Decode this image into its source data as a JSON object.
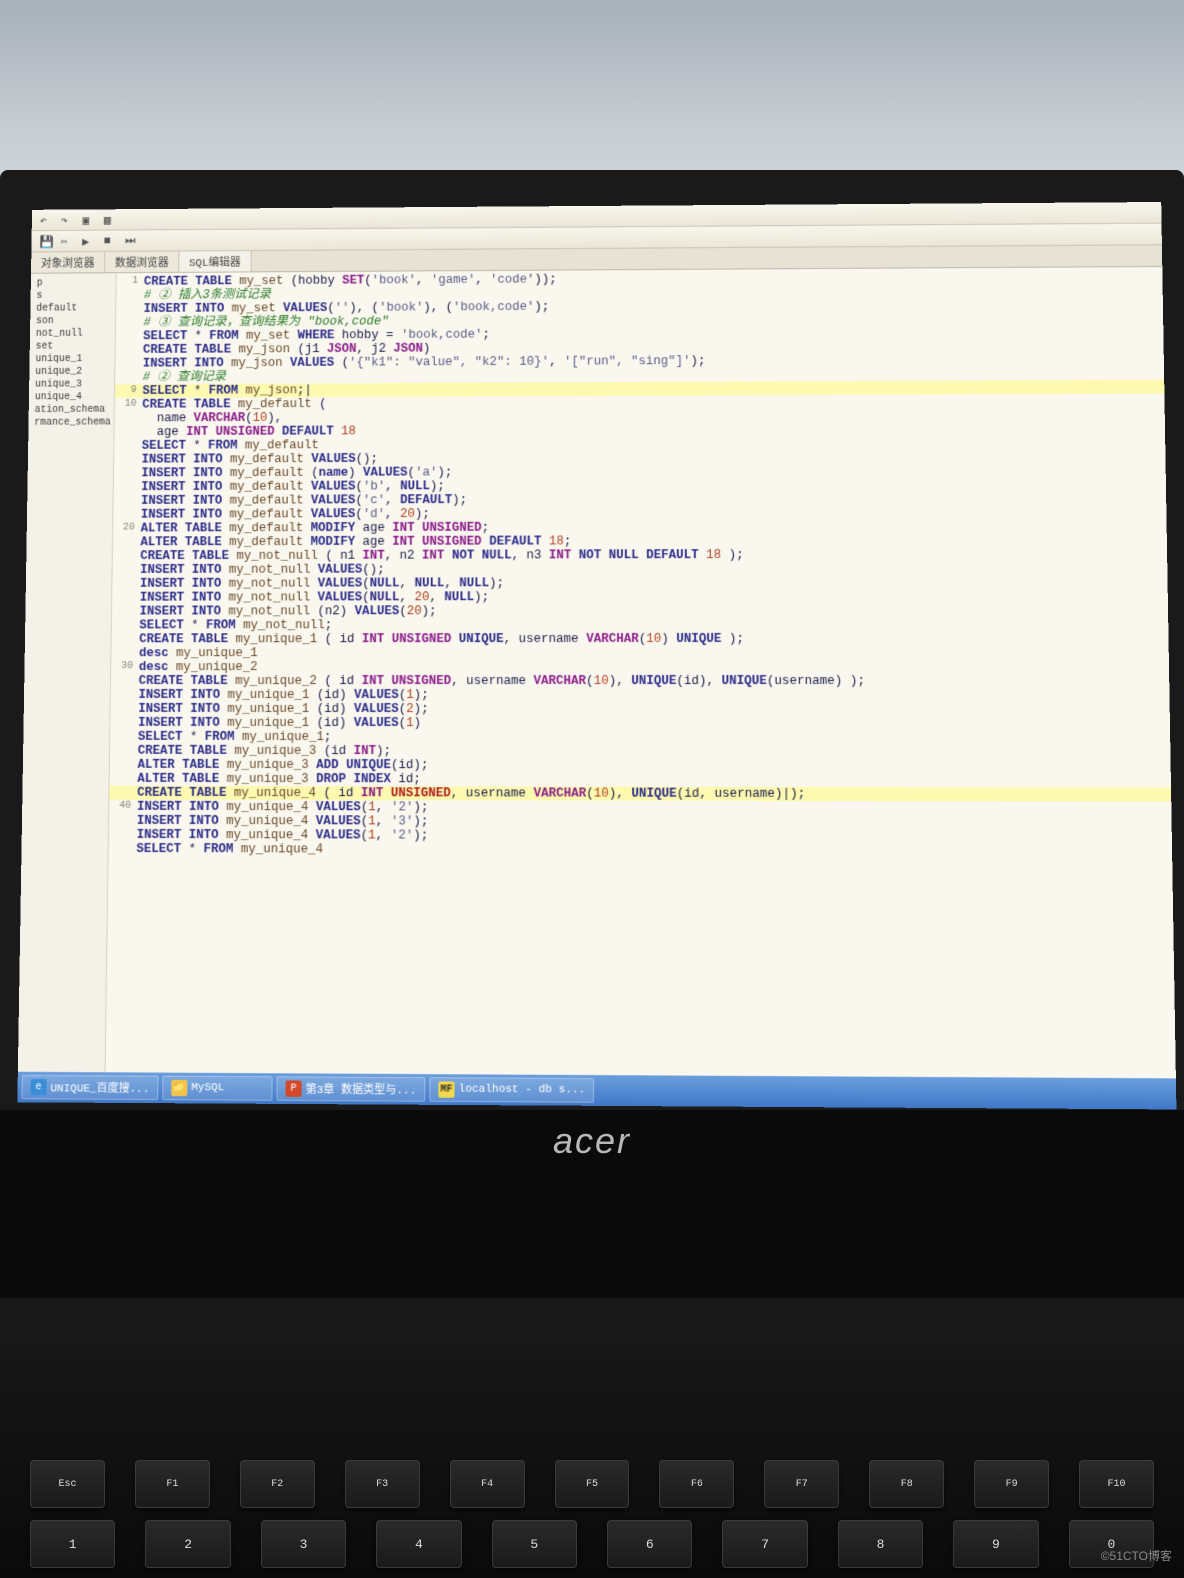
{
  "toolbar": {
    "icons": [
      "undo-icon",
      "redo-icon",
      "copy-icon",
      "paste-icon",
      "save-icon",
      "run-icon",
      "stop-icon",
      "step-icon"
    ]
  },
  "tabs": {
    "browser_tab": "对象浏览器",
    "data_tab": "数据浏览器",
    "sql_tab": "SQL编辑器"
  },
  "sidebar": {
    "items": [
      "p",
      "s",
      "default",
      "son",
      "not_null",
      "set",
      "unique_1",
      "unique_2",
      "unique_3",
      "unique_4",
      "ation_schema",
      "rmance_schema"
    ]
  },
  "code": {
    "lines": [
      {
        "n": "1",
        "t": "<kw>CREATE TABLE</kw> <id>my_set</id> (hobby <ty>SET</ty>(<st>'book'</st>, <st>'game'</st>, <st>'code'</st>));"
      },
      {
        "n": "",
        "t": "<cm># ② 插入3条测试记录</cm>"
      },
      {
        "n": "",
        "t": "<kw>INSERT INTO</kw> <id>my_set</id> <kw>VALUES</kw>(<st>''</st>), (<st>'book'</st>), (<st>'book,code'</st>);"
      },
      {
        "n": "",
        "t": "<cm># ③ 查询记录，查询结果为 \"book,code\"</cm>"
      },
      {
        "n": "",
        "t": "<kw>SELECT</kw> * <kw>FROM</kw> <id>my_set</id> <kw>WHERE</kw> hobby = <st>'book,code'</st>;"
      },
      {
        "n": "",
        "t": "<kw>CREATE TABLE</kw> <id>my_json</id> (j1 <ty>JSON</ty>, j2 <ty>JSON</ty>)"
      },
      {
        "n": "",
        "t": "<kw>INSERT INTO</kw> <id>my_json</id> <kw>VALUES</kw> (<st>'{\"k1\": \"value\", \"k2\": 10}'</st>, <st>'[\"run\", \"sing\"]'</st>);"
      },
      {
        "n": "",
        "t": "<cm># ② 查询记录</cm>"
      },
      {
        "n": "9",
        "t": "<kw>SELECT</kw> * <kw>FROM</kw> <id>my_json</id>;|",
        "hl": true
      },
      {
        "n": "10",
        "t": "<kw>CREATE TABLE</kw> <id>my_default</id> ("
      },
      {
        "n": "",
        "t": "  name <ty>VARCHAR</ty>(<nu>10</nu>),"
      },
      {
        "n": "",
        "t": "  age <ty>INT UNSIGNED</ty> <kw>DEFAULT</kw> <nu>18</nu>"
      },
      {
        "n": "",
        "t": ""
      },
      {
        "n": "",
        "t": "<kw>SELECT</kw> * <kw>FROM</kw> <id>my_default</id>"
      },
      {
        "n": "",
        "t": "<kw>INSERT INTO</kw> <id>my_default</id> <kw>VALUES</kw>();"
      },
      {
        "n": "",
        "t": "<kw>INSERT INTO</kw> <id>my_default</id> (<kw>name</kw>) <kw>VALUES</kw>(<st>'a'</st>);"
      },
      {
        "n": "",
        "t": "<kw>INSERT INTO</kw> <id>my_default</id> <kw>VALUES</kw>(<st>'b'</st>, <kw>NULL</kw>);"
      },
      {
        "n": "",
        "t": "<kw>INSERT INTO</kw> <id>my_default</id> <kw>VALUES</kw>(<st>'c'</st>, <kw>DEFAULT</kw>);"
      },
      {
        "n": "",
        "t": "<kw>INSERT INTO</kw> <id>my_default</id> <kw>VALUES</kw>(<st>'d'</st>, <nu>20</nu>);"
      },
      {
        "n": "20",
        "t": "<kw>ALTER TABLE</kw> <id>my_default</id> <kw>MODIFY</kw> age <ty>INT UNSIGNED</ty>;"
      },
      {
        "n": "",
        "t": "<kw>ALTER TABLE</kw> <id>my_default</id> <kw>MODIFY</kw> age <ty>INT UNSIGNED</ty> <kw>DEFAULT</kw> <nu>18</nu>;"
      },
      {
        "n": "",
        "t": "<kw>CREATE TABLE</kw> <id>my_not_null</id> ( n1 <ty>INT</ty>, n2 <ty>INT</ty> <kw>NOT</kw> <kw>NULL</kw>, n3 <ty>INT</ty> <kw>NOT</kw> <kw>NULL</kw> <kw>DEFAULT</kw> <nu>18</nu> );"
      },
      {
        "n": "",
        "t": "<kw>INSERT INTO</kw> <id>my_not_null</id> <kw>VALUES</kw>();"
      },
      {
        "n": "",
        "t": "<kw>INSERT INTO</kw> <id>my_not_null</id> <kw>VALUES</kw>(<kw>NULL</kw>, <kw>NULL</kw>, <kw>NULL</kw>);"
      },
      {
        "n": "",
        "t": "<kw>INSERT INTO</kw> <id>my_not_null</id> <kw>VALUES</kw>(<kw>NULL</kw>, <nu>20</nu>, <kw>NULL</kw>);"
      },
      {
        "n": "",
        "t": "<kw>INSERT INTO</kw> <id>my_not_null</id> (n2) <kw>VALUES</kw>(<nu>20</nu>);"
      },
      {
        "n": "",
        "t": "<kw>SELECT</kw> * <kw>FROM</kw> <id>my_not_null</id>;"
      },
      {
        "n": "",
        "t": "<kw>CREATE TABLE</kw> <id>my_unique_1</id> ( id <ty>INT UNSIGNED</ty> <kw>UNIQUE</kw>, username <ty>VARCHAR</ty>(<nu>10</nu>) <kw>UNIQUE</kw> );"
      },
      {
        "n": "",
        "t": "<kw>desc</kw> <id>my_unique_1</id>"
      },
      {
        "n": "30",
        "t": "<kw>desc</kw> <id>my_unique_2</id>"
      },
      {
        "n": "",
        "t": "<kw>CREATE TABLE</kw> <id>my_unique_2</id> ( id <ty>INT UNSIGNED</ty>, username <ty>VARCHAR</ty>(<nu>10</nu>), <kw>UNIQUE</kw>(id), <kw>UNIQUE</kw>(username) );"
      },
      {
        "n": "",
        "t": "<kw>INSERT INTO</kw> <id>my_unique_1</id> (id) <kw>VALUES</kw>(<nu>1</nu>);"
      },
      {
        "n": "",
        "t": "<kw>INSERT INTO</kw> <id>my_unique_1</id> (id) <kw>VALUES</kw>(<nu>2</nu>);"
      },
      {
        "n": "",
        "t": "<kw>INSERT INTO</kw> <id>my_unique_1</id> (id) <kw>VALUES</kw>(<nu>1</nu>)"
      },
      {
        "n": "",
        "t": "<kw>SELECT</kw> * <kw>FROM</kw> <id>my_unique_1</id>;"
      },
      {
        "n": "",
        "t": "<kw>CREATE TABLE</kw> <id>my_unique_3</id> (id <ty>INT</ty>);"
      },
      {
        "n": "",
        "t": "<kw>ALTER TABLE</kw> <id>my_unique_3</id> <kw>ADD</kw> <kw>UNIQUE</kw>(id);"
      },
      {
        "n": "",
        "t": "<kw>ALTER TABLE</kw> <id>my_unique_3</id> <kw>DROP INDEX</kw> id;"
      },
      {
        "n": "",
        "t": "<kw>CREATE TABLE</kw> <id>my_unique_4</id> ( id <ty>INT</ty> <er>UNSIGNED</er>, username <ty>VARCHAR</ty>(<nu>10</nu>), <kw>UNIQUE</kw>(id, username)|);",
        "hl": true
      },
      {
        "n": "40",
        "t": "<kw>INSERT INTO</kw> <id>my_unique_4</id> <kw>VALUES</kw>(<nu>1</nu>, <st>'2'</st>);"
      },
      {
        "n": "",
        "t": "<kw>INSERT INTO</kw> <id>my_unique_4</id> <kw>VALUES</kw>(<nu>1</nu>, <st>'3'</st>);"
      },
      {
        "n": "",
        "t": "<kw>INSERT INTO</kw> <id>my_unique_4</id> <kw>VALUES</kw>(<nu>1</nu>, <st>'2'</st>);"
      },
      {
        "n": "",
        "t": "<kw>SELECT</kw> * <kw>FROM</kw> <id>my_unique_4</id>"
      }
    ]
  },
  "taskbar": {
    "items": [
      {
        "icon": "ie",
        "label": "UNIQUE_百度搜..."
      },
      {
        "icon": "folder",
        "label": "MySQL"
      },
      {
        "icon": "ppt",
        "label": "第3章 数据类型与..."
      },
      {
        "icon": "mf",
        "label": "localhost - db s..."
      }
    ]
  },
  "monitor_brand": "acer",
  "keyboard": {
    "fn_row": [
      "Esc",
      "F1",
      "F2",
      "F3",
      "F4",
      "F5",
      "F6",
      "F7",
      "F8",
      "F9",
      "F10"
    ],
    "num_row": [
      "1",
      "2",
      "3",
      "4",
      "5",
      "6",
      "7",
      "8",
      "9",
      "0"
    ]
  },
  "watermark": "©51CTO博客"
}
